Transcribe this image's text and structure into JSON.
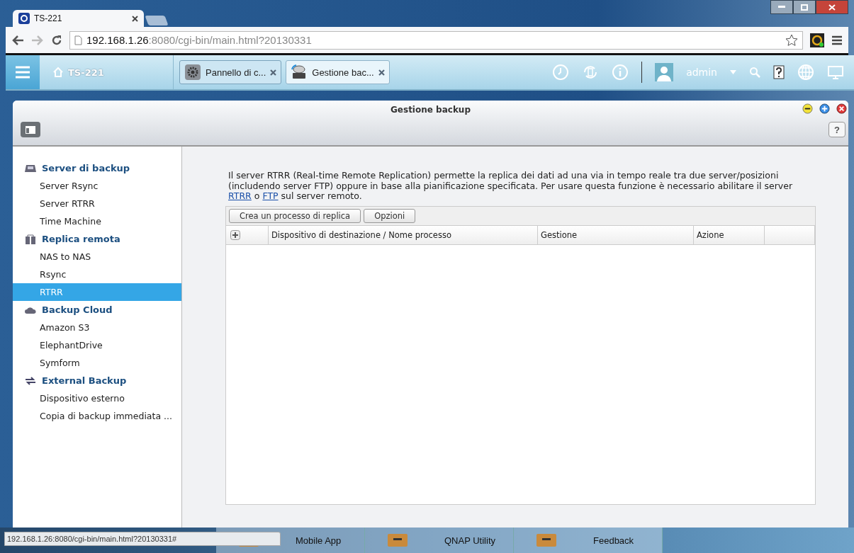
{
  "browser": {
    "tabs": [
      {
        "title": "TS-221",
        "selected": true
      }
    ],
    "address": {
      "host": "192.168.1.26",
      "path": ":8080/cgi-bin/main.html?20130331"
    }
  },
  "header": {
    "home": "TS-221",
    "apps": [
      {
        "label": "Pannello di c...",
        "kind": "gear",
        "selected": false
      },
      {
        "label": "Gestione bac...",
        "kind": "backup",
        "selected": true
      }
    ],
    "user": "admin"
  },
  "window": {
    "title": "Gestione backup",
    "help": "?"
  },
  "sidebar": {
    "groups": [
      {
        "label": "Server di backup",
        "kind": "drive",
        "items": [
          {
            "label": "Server Rsync",
            "selected": false
          },
          {
            "label": "Server RTRR",
            "selected": false
          },
          {
            "label": "Time Machine",
            "selected": false
          }
        ]
      },
      {
        "label": "Replica remota",
        "kind": "nas",
        "items": [
          {
            "label": "NAS to NAS",
            "selected": false
          },
          {
            "label": "Rsync",
            "selected": false
          },
          {
            "label": "RTRR",
            "selected": true
          }
        ]
      },
      {
        "label": "Backup Cloud",
        "kind": "cloud",
        "items": [
          {
            "label": "Amazon S3",
            "selected": false
          },
          {
            "label": "ElephantDrive",
            "selected": false
          },
          {
            "label": "Symform",
            "selected": false
          }
        ]
      },
      {
        "label": "External Backup",
        "kind": "sync",
        "items": [
          {
            "label": "Dispositivo esterno",
            "selected": false
          },
          {
            "label": "Copia di backup immediata ...",
            "selected": false
          }
        ]
      }
    ]
  },
  "content": {
    "description": [
      {
        "text": "Il server RTRR (Real-time Remote Replication) permette la replica dei dati ad una via in tempo reale tra due server/posizioni (includendo server FTP) oppure in base alla pianificazione specificata. Per usare questa funzione è necessario abilitare il server ",
        "kind": "text"
      },
      {
        "text": "RTRR",
        "kind": "link"
      },
      {
        "text": " o ",
        "kind": "text"
      },
      {
        "text": "FTP",
        "kind": "link"
      },
      {
        "text": " sul server remoto.",
        "kind": "text"
      }
    ],
    "buttons": [
      "Crea un processo di replica",
      "Opzioni"
    ],
    "columns": [
      "Dispositivo di destinazione / Nome processo",
      "Gestione",
      "Azione"
    ]
  },
  "dock": [
    "Mobile App",
    "QNAP Utility",
    "Feedback"
  ],
  "status_url": "192.168.1.26:8080/cgi-bin/main.html?20130331#"
}
